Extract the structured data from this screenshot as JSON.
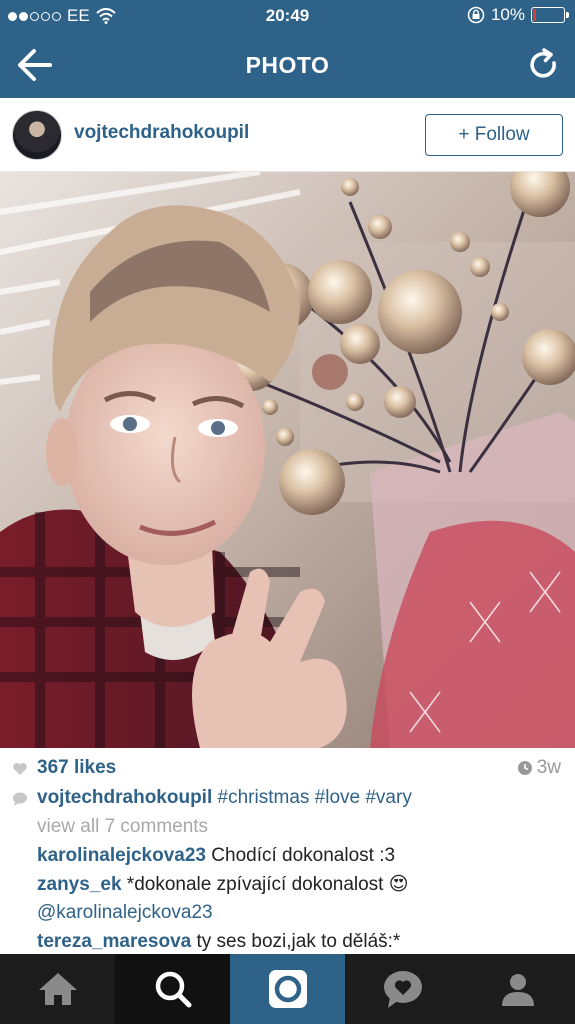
{
  "status_bar": {
    "carrier": "EE",
    "time": "20:49",
    "battery_percent": "10%",
    "battery_level": 0.1,
    "signal_bars_filled": 2,
    "signal_bars_total": 5
  },
  "nav": {
    "title": "PHOTO",
    "back_icon": "arrow-left-icon",
    "refresh_icon": "refresh-icon"
  },
  "post": {
    "username": "vojtechdrahokoupil",
    "follow_label": "+ Follow",
    "likes": "367 likes",
    "age": "3w",
    "caption": {
      "username": "vojtechdrahokoupil",
      "text": "#christmas #love #vary"
    },
    "view_all_comments": "view all 7 comments",
    "comments": [
      {
        "user": "karolinalejckova23",
        "text": "Chodící dokonalost :3"
      },
      {
        "user": "zanys_ek",
        "text": "*dokonale zpívající dokonalost 😍"
      },
      {
        "user": "",
        "text": "@karolinalejckova23"
      },
      {
        "user": "tereza_maresova",
        "text": "ty ses bozi,jak to děláš:*"
      }
    ]
  },
  "tab_bar": {
    "tabs": [
      "home-icon",
      "search-icon",
      "camera-icon",
      "activity-icon",
      "profile-icon"
    ],
    "active_tab": "search-icon",
    "accent": "#2f6288"
  },
  "colors": {
    "brand": "#2f6288",
    "tab_bar_bg": "#1c1c1c",
    "battery_low": "#e23a2e"
  }
}
